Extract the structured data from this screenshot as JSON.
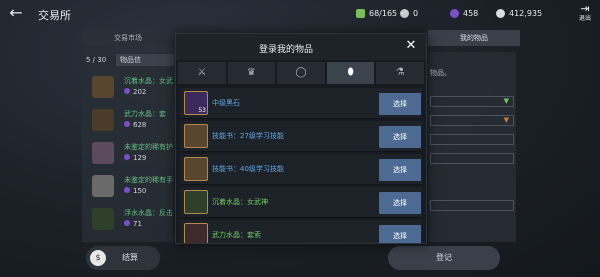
{
  "topbar": {
    "back_glyph": "←",
    "title": "交易所",
    "bag": "68/165",
    "silver": "0",
    "crystal": "458",
    "gold": "412,935",
    "exit_label": "退出",
    "exit_glyph": "⇥",
    "icons": {
      "bag": "bag-icon",
      "silver": "silver-coin-icon",
      "crystal": "crystal-icon",
      "gold": "gold-coin-icon"
    }
  },
  "market": {
    "tab_market": "交易市场",
    "tab_mine": "我的物品",
    "count": "5 / 30",
    "list_tab": "物品信",
    "items": [
      {
        "name": "沉着水晶：女武",
        "price": "202"
      },
      {
        "name": "武力水晶：套",
        "price": "628"
      },
      {
        "name": "未鉴定的稀有护",
        "price": "129"
      },
      {
        "name": "未鉴定的稀有手",
        "price": "150"
      },
      {
        "name": "浮水水晶：反击",
        "price": "71"
      }
    ],
    "right_text": "物品。",
    "settle_label": "结算",
    "register_label": "登记"
  },
  "modal": {
    "title": "登录我的物品",
    "close_glyph": "✕",
    "tabs": [
      "⚔",
      "♛",
      "◯",
      "⬮",
      "⚗"
    ],
    "active_tab": 3,
    "select_label": "选择",
    "rows": [
      {
        "name": "中级黑石",
        "qty": "53",
        "color": "#5fa8e6",
        "thumb": "#3c2a5c"
      },
      {
        "name": "技能书：27级学习技能",
        "qty": "",
        "color": "#5fa8e6",
        "thumb": "#5a4630"
      },
      {
        "name": "技能书：40级学习技能",
        "qty": "",
        "color": "#5fa8e6",
        "thumb": "#5a4630"
      },
      {
        "name": "沉着水晶：女武神",
        "qty": "",
        "color": "#6ccb5f",
        "thumb": "#2e3f2a"
      },
      {
        "name": "武力水晶：套索",
        "qty": "",
        "color": "#6ccb5f",
        "thumb": "#3e2a2a"
      }
    ]
  },
  "colors": {
    "accent_button": "#4d6a93",
    "green_text": "#6ccb5f",
    "blue_text": "#5fa8e6",
    "purple": "#7b4fc9"
  }
}
